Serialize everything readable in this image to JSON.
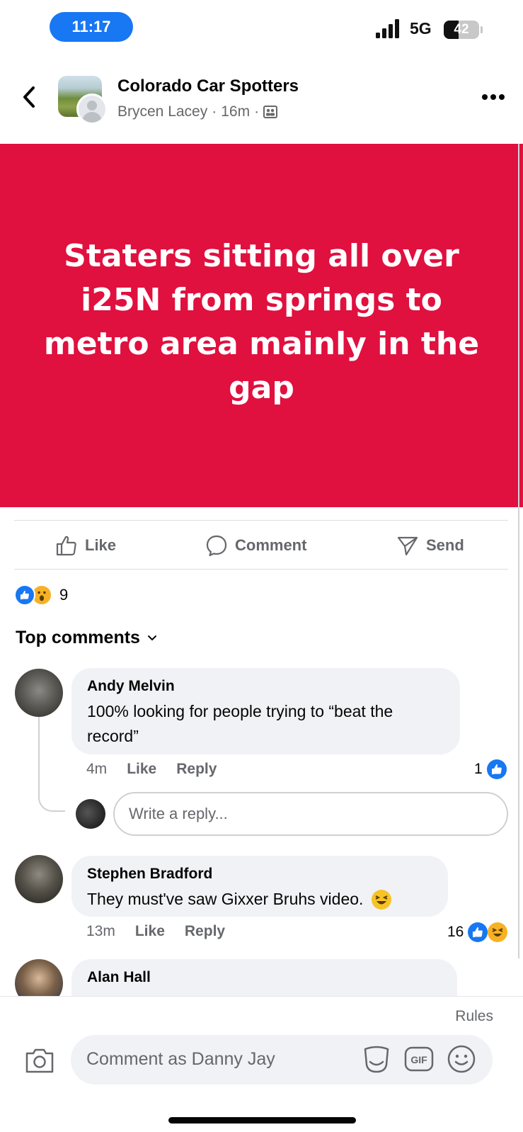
{
  "status_bar": {
    "time": "11:17",
    "network": "5G",
    "battery": "42"
  },
  "header": {
    "group_name": "Colorado Car Spotters",
    "author": "Brycen Lacey",
    "separator": "·",
    "time_ago": "16m"
  },
  "post": {
    "text": "Staters sitting all over i25N from springs to metro area mainly in the gap",
    "background_color": "#e0103f"
  },
  "actions": {
    "like": "Like",
    "comment": "Comment",
    "send": "Send"
  },
  "reactions": {
    "count": "9",
    "types": [
      "like",
      "wow"
    ]
  },
  "comments_header": {
    "label": "Top comments"
  },
  "comments": [
    {
      "name": "Andy Melvin",
      "text": "100% looking for people trying to “beat the record”",
      "time": "4m",
      "like": "Like",
      "reply": "Reply",
      "reaction_count": "1"
    },
    {
      "name": "Stephen Bradford",
      "text": "They must've saw Gixxer Bruhs video.",
      "time": "13m",
      "like": "Like",
      "reply": "Reply",
      "reaction_count": "16"
    },
    {
      "name": "Alan Hall"
    }
  ],
  "reply_box": {
    "placeholder": "Write a reply..."
  },
  "composer": {
    "rules": "Rules",
    "placeholder": "Comment as Danny Jay",
    "gif": "GIF"
  }
}
